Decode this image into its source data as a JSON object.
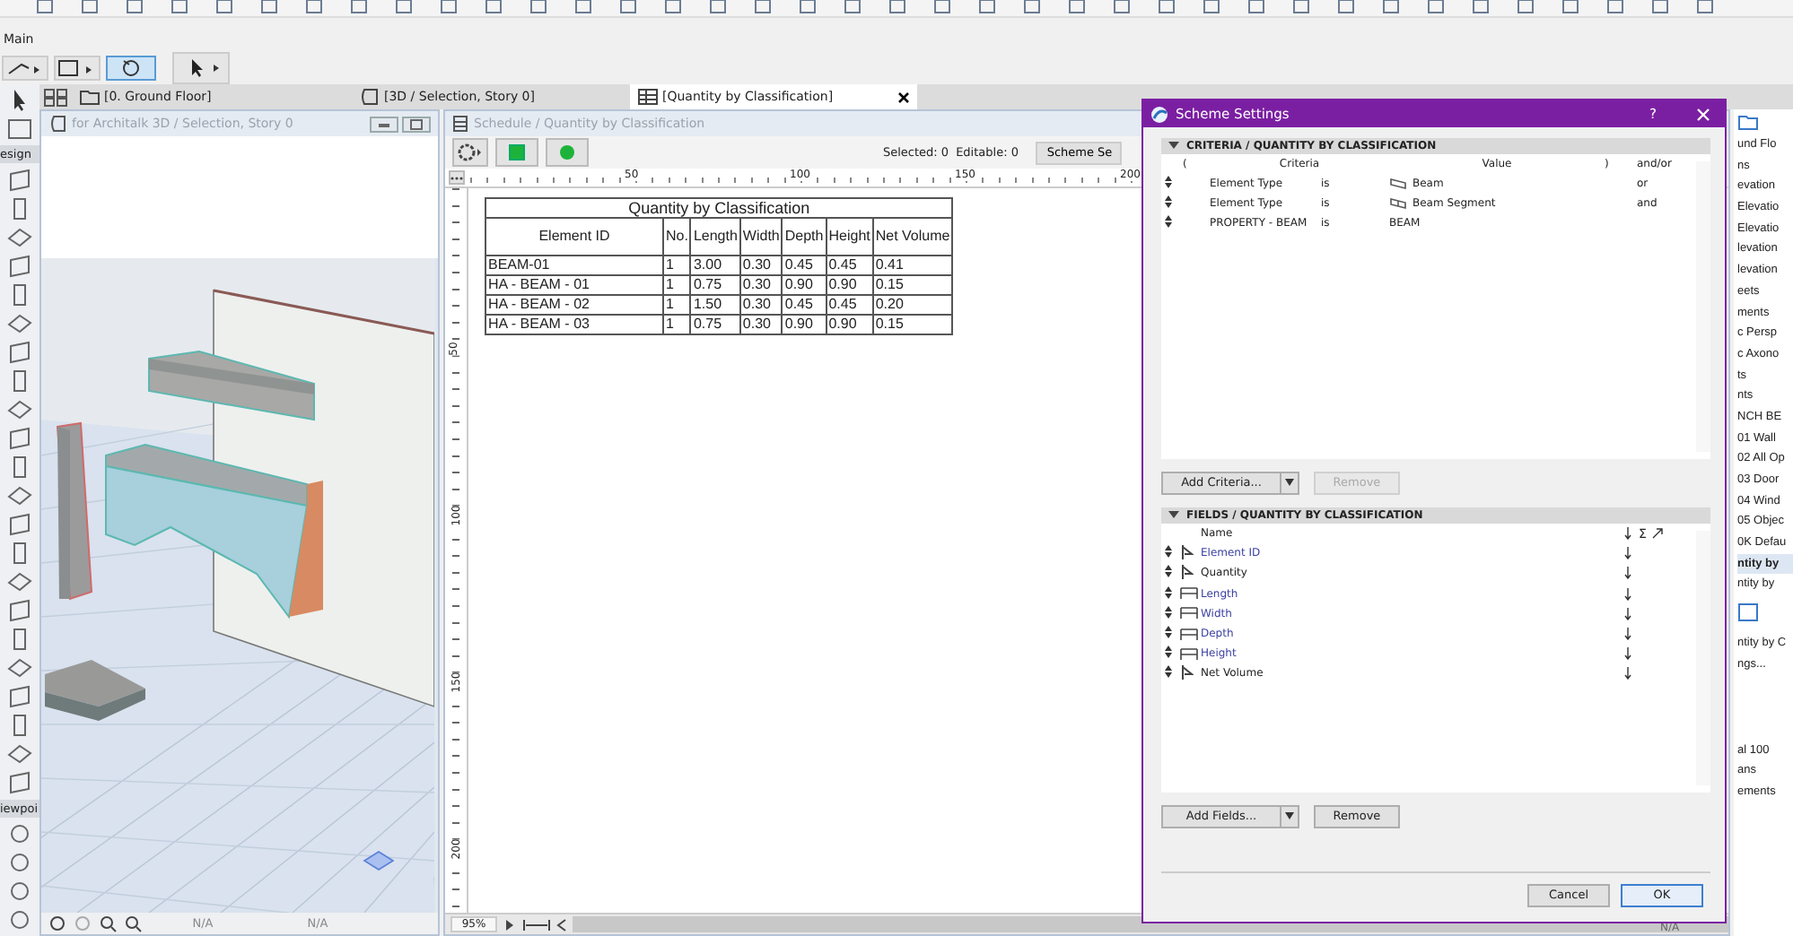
{
  "toolbar": {
    "label": "Main"
  },
  "tabs": [
    {
      "label": "[0. Ground Floor]",
      "selected": false,
      "kind": "plan"
    },
    {
      "label": "[3D / Selection, Story 0]",
      "selected": false,
      "kind": "model"
    },
    {
      "label": "[Quantity by Classification]",
      "selected": true,
      "kind": "schedule"
    }
  ],
  "toolbox": {
    "sections": [
      "esign",
      "iewpoi"
    ]
  },
  "view3d": {
    "title": "for Architalk 3D / Selection, Story 0",
    "readouts": [
      "N/A",
      "N/A"
    ]
  },
  "schedule": {
    "title": "Schedule /  Quantity by Classification",
    "selected": "Selected: 0",
    "editable": "Editable: 0",
    "scheme_button": "Scheme Se",
    "ruler": [
      "50",
      "100",
      "150",
      "200"
    ],
    "vruler": [
      "50",
      "100",
      "150",
      "200"
    ],
    "zoom": "95%",
    "table": {
      "title": "Quantity by Classification",
      "columns": [
        "Element ID",
        "No.",
        "Length",
        "Width",
        "Depth",
        "Height",
        "Net Volume"
      ],
      "rows": [
        [
          "BEAM-01",
          "1",
          "3.00",
          "0.30",
          "0.45",
          "0.45",
          "0.41"
        ],
        [
          "HA - BEAM - 01",
          "1",
          "0.75",
          "0.30",
          "0.90",
          "0.90",
          "0.15"
        ],
        [
          "HA - BEAM - 02",
          "1",
          "1.50",
          "0.30",
          "0.45",
          "0.45",
          "0.20"
        ],
        [
          "HA - BEAM - 03",
          "1",
          "0.75",
          "0.30",
          "0.90",
          "0.90",
          "0.15"
        ]
      ]
    }
  },
  "dialog": {
    "title": "Scheme Settings",
    "help": "?",
    "criteria": {
      "header": "CRITERIA / QUANTITY BY CLASSIFICATION",
      "columns": [
        "(",
        "Criteria",
        "Value",
        ")",
        "and/or"
      ],
      "rows": [
        {
          "criteria": "Element Type",
          "op": "is",
          "value": "Beam",
          "kind": "beam",
          "andor": "or"
        },
        {
          "criteria": "Element Type",
          "op": "is",
          "value": "Beam Segment",
          "kind": "segment",
          "andor": "and"
        },
        {
          "criteria": "PROPERTY - BEAM",
          "op": "is",
          "value": "BEAM",
          "kind": "text"
        }
      ],
      "add": "Add Criteria...",
      "remove": {
        "label": "Remove",
        "disabled": true
      }
    },
    "fields": {
      "header": "FIELDS / QUANTITY BY CLASSIFICATION",
      "name_column": "Name",
      "sum": "Σ",
      "rows": [
        {
          "name": "Element ID",
          "kind": "property",
          "linked": true
        },
        {
          "name": "Quantity",
          "kind": "property",
          "linked": false
        },
        {
          "name": "Length",
          "kind": "dimension",
          "linked": true
        },
        {
          "name": "Width",
          "kind": "dimension",
          "linked": true
        },
        {
          "name": "Depth",
          "kind": "dimension",
          "linked": true
        },
        {
          "name": "Height",
          "kind": "dimension",
          "linked": true
        },
        {
          "name": "Net Volume",
          "kind": "property",
          "linked": false
        }
      ],
      "add": "Add Fields...",
      "remove": {
        "label": "Remove",
        "disabled": false
      }
    },
    "cancel": "Cancel",
    "ok": "OK"
  },
  "navigator": {
    "items": [
      {
        "label": "und Flo",
        "selected": false
      },
      {
        "label": "ns",
        "selected": false
      },
      {
        "label": "evation",
        "selected": false
      },
      {
        "label": "Elevatio",
        "selected": false
      },
      {
        "label": "Elevatio",
        "selected": false
      },
      {
        "label": "levation",
        "selected": false
      },
      {
        "label": "levation",
        "selected": false
      },
      {
        "label": "eets",
        "selected": false
      },
      {
        "label": "ments",
        "selected": false
      },
      {
        "label": "c Persp",
        "selected": false
      },
      {
        "label": "c Axono",
        "selected": false
      },
      {
        "label": "ts",
        "selected": false
      },
      {
        "label": "nts",
        "selected": false
      },
      {
        "label": "NCH BE",
        "selected": false
      },
      {
        "label": "01 Wall",
        "selected": false
      },
      {
        "label": "02 All Op",
        "selected": false
      },
      {
        "label": "03 Door",
        "selected": false
      },
      {
        "label": "04 Wind",
        "selected": false
      },
      {
        "label": "05 Objec",
        "selected": false
      },
      {
        "label": "0K Defau",
        "selected": false
      },
      {
        "label": "ntity by",
        "selected": true
      },
      {
        "label": "ntity by",
        "selected": false
      }
    ],
    "lower": [
      "ntity by C",
      "ngs...",
      "al 100",
      "ans",
      "ements"
    ],
    "readout": "N/A"
  }
}
